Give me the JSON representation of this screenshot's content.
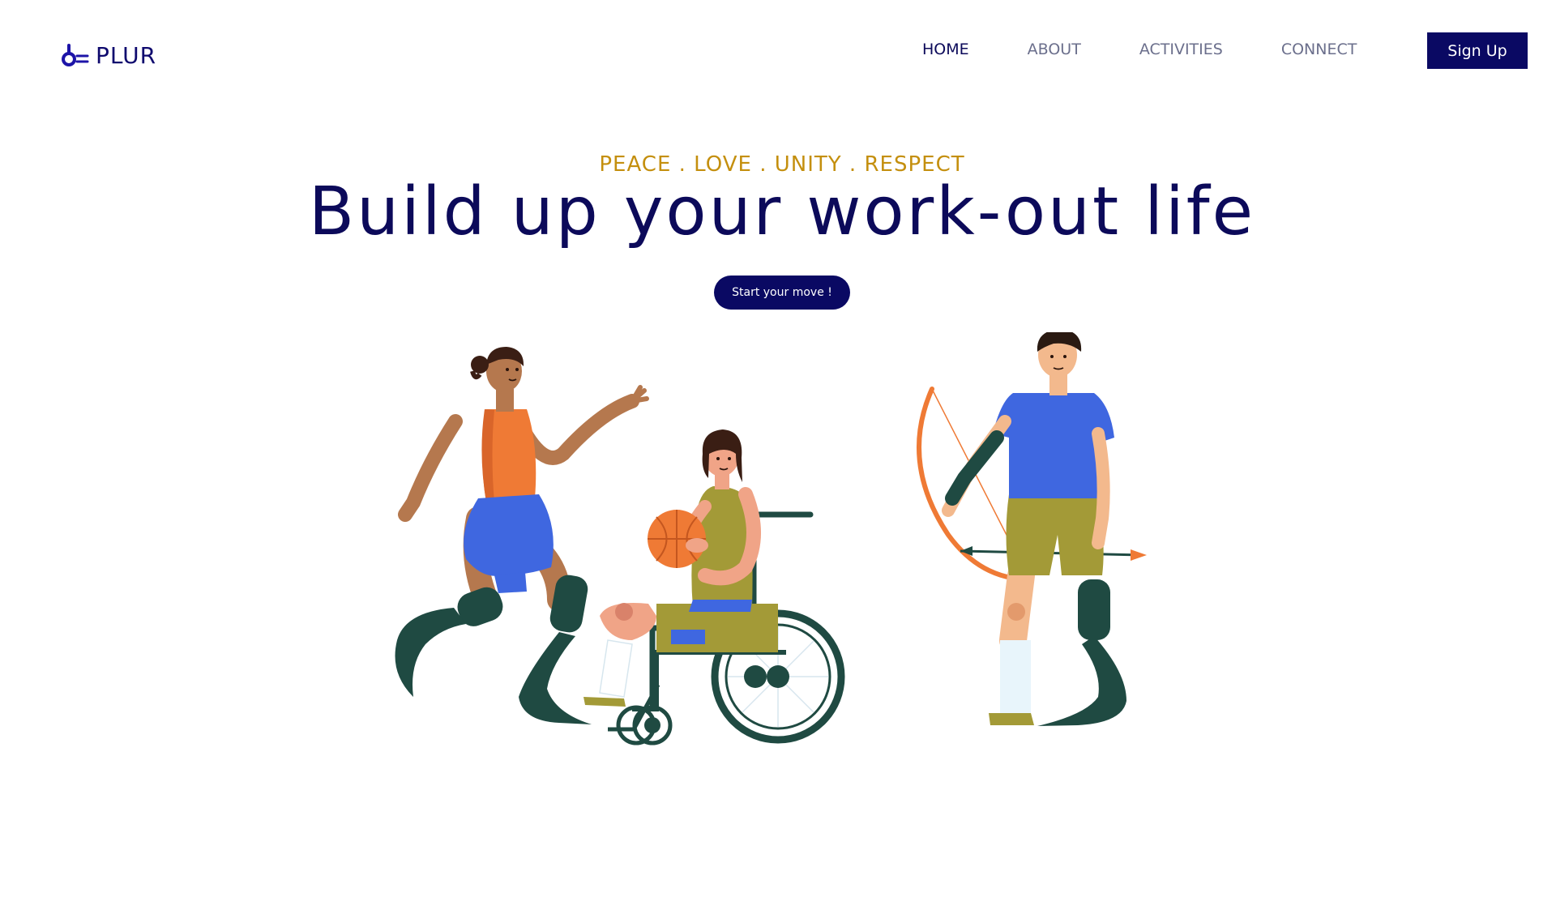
{
  "header": {
    "logo_text": "PLUR",
    "logo_icon": "plur-logo-icon",
    "nav": [
      {
        "label": "HOME",
        "active": true
      },
      {
        "label": "ABOUT",
        "active": false
      },
      {
        "label": "ACTIVITIES",
        "active": false
      },
      {
        "label": "CONNECT",
        "active": false
      }
    ],
    "signup_label": "Sign Up"
  },
  "hero": {
    "tagline": "PEACE .  LOVE .  UNITY . RESPECT",
    "headline": "Build up your work-out life",
    "cta_label": "Start your move !"
  },
  "colors": {
    "brand_navy": "#0a0963",
    "accent_gold": "#c48f0e",
    "nav_text": "#6b6f8c",
    "prosthetic_green": "#1f4a42",
    "orange": "#ef7a35",
    "blue": "#3f67e0",
    "olive": "#a39a37"
  }
}
